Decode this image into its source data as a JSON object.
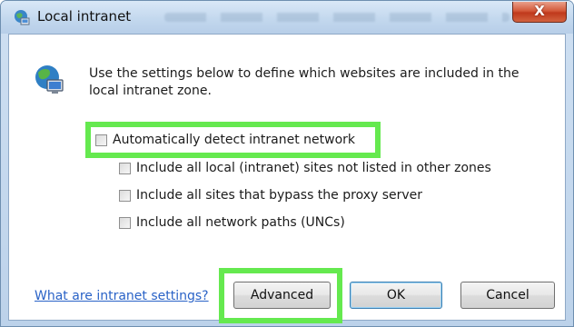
{
  "window": {
    "title": "Local intranet",
    "close_label": "X"
  },
  "description": "Use the settings below to define which websites are included in the local intranet zone.",
  "options": [
    {
      "label": "Automatically detect intranet network",
      "checked": false
    },
    {
      "label": "Include all local (intranet) sites not listed in other zones",
      "checked": false
    },
    {
      "label": "Include all sites that bypass the proxy server",
      "checked": false
    },
    {
      "label": "Include all network paths (UNCs)",
      "checked": false
    }
  ],
  "help_link": "What are intranet settings?",
  "buttons": {
    "advanced": "Advanced",
    "ok": "OK",
    "cancel": "Cancel"
  },
  "colors": {
    "highlight": "#65e94f",
    "link": "#2a63c7"
  },
  "icons": {
    "title": "intranet-zone-icon",
    "zone": "globe-computer-icon"
  }
}
